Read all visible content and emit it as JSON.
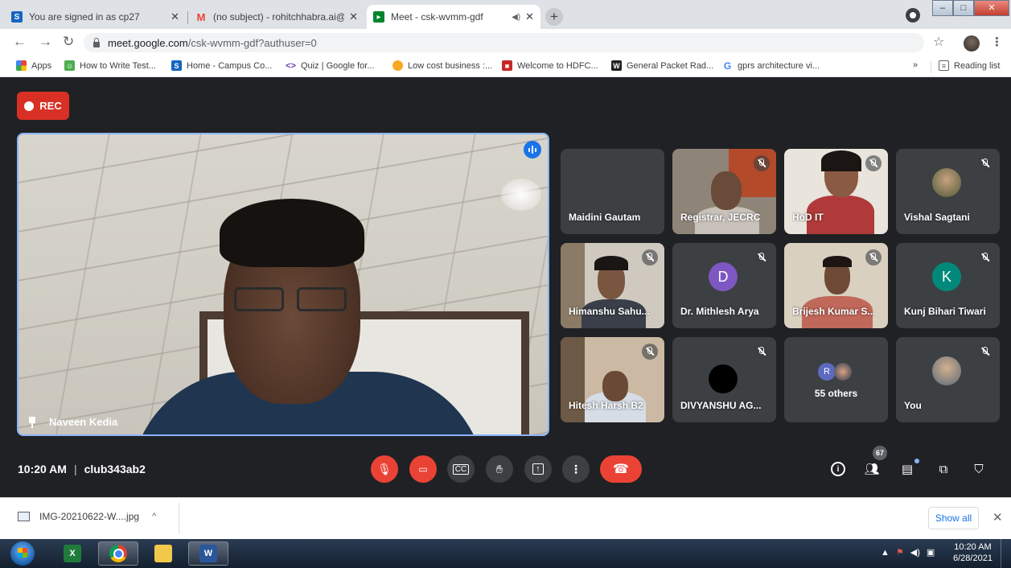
{
  "browser": {
    "tabs": [
      {
        "title": "You are signed in as cp27",
        "favicon": "S",
        "favicon_color": "#1565c0"
      },
      {
        "title": "(no subject) - rohitchhabra.ai@je",
        "favicon": "M",
        "favicon_color": "#ea4335"
      },
      {
        "title": "Meet - csk-wvmm-gdf",
        "favicon": "meet-icon",
        "favicon_color": "#00832d"
      }
    ],
    "url_host": "meet.google.com",
    "url_path": "/csk-wvmm-gdf?authuser=0",
    "bookmarks": [
      {
        "label": "Apps",
        "icon": "apps-grid-icon"
      },
      {
        "label": "How to Write Test...",
        "icon": "dudes-icon"
      },
      {
        "label": "Home - Campus Co...",
        "icon": "S"
      },
      {
        "label": "Quiz | Google for...",
        "icon": "code-icon"
      },
      {
        "label": "Low cost business :...",
        "icon": "orange-dot-icon"
      },
      {
        "label": "Welcome to HDFC...",
        "icon": "hdfc-icon"
      },
      {
        "label": "General Packet Rad...",
        "icon": "W"
      },
      {
        "label": "gprs architecture vi...",
        "icon": "G"
      }
    ],
    "more_bookmarks": "»",
    "reading_list": "Reading list"
  },
  "meet": {
    "rec_label": "REC",
    "main": {
      "name": "Naveen Kedia"
    },
    "tiles": [
      {
        "name": "Maidini Gautam",
        "type": "blank"
      },
      {
        "name": "Registrar, JECRC",
        "type": "video"
      },
      {
        "name": "HoD IT",
        "type": "video"
      },
      {
        "name": "Vishal Sagtani",
        "type": "photo"
      },
      {
        "name": "Himanshu Sahu...",
        "type": "video"
      },
      {
        "name": "Dr. Mithlesh Arya",
        "type": "letter",
        "letter": "D",
        "color": "#7e57c2"
      },
      {
        "name": "Brijesh Kumar S...",
        "type": "video"
      },
      {
        "name": "Kunj Bihari Tiwari",
        "type": "letter",
        "letter": "K",
        "color": "#00897b"
      },
      {
        "name": "Hitesh Harsh B2",
        "type": "video"
      },
      {
        "name": "DIVYANSHU AG...",
        "type": "blackdot"
      },
      {
        "name": "55 others",
        "type": "others",
        "letter": "R"
      },
      {
        "name": "You",
        "type": "photo"
      }
    ],
    "time": "10:20 AM",
    "separator": "|",
    "meeting_code": "club343ab2",
    "people_count": "67"
  },
  "downloads": {
    "file": "IMG-20210622-W....jpg",
    "show_all": "Show all"
  },
  "taskbar": {
    "time": "10:20 AM",
    "date": "6/28/2021"
  }
}
